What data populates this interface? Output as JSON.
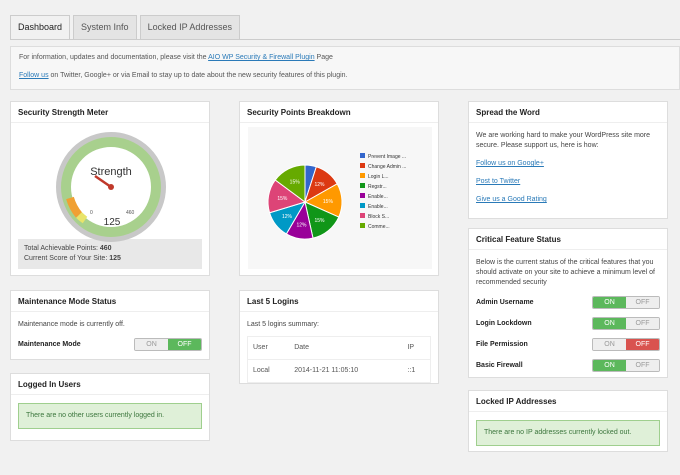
{
  "tabs": [
    "Dashboard",
    "System Info",
    "Locked IP Addresses"
  ],
  "notice": {
    "line1_prefix": "For information, updates and documentation, please visit the",
    "line1_link": "AIO WP Security & Firewall Plugin",
    "line1_suffix": "Page",
    "line2_link": "Follow us",
    "line2_text": "on Twitter, Google+ or via Email to stay up to date about the new security features of this plugin."
  },
  "meter": {
    "title": "Security Strength Meter",
    "gauge_label": "Strength",
    "score": "125",
    "min": "0",
    "max": "460",
    "value": 125,
    "total_label": "Total Achievable Points:",
    "total_value": "460",
    "current_label": "Current Score of Your Site:",
    "current_value": "125"
  },
  "breakdown": {
    "title": "Security Points Breakdown",
    "chart_data": {
      "type": "pie",
      "labels": [
        "Prevent Image...",
        "Change Admin ...",
        "Login L...",
        "Regstr...",
        "Enable...",
        "Enable...",
        "Block S...",
        "Comme..."
      ],
      "values": [
        5,
        12,
        15,
        15,
        12,
        12,
        15,
        15
      ],
      "slice_labels": [
        "",
        "12%",
        "15%",
        "15%",
        "12%",
        "12%",
        "15%",
        "15%"
      ],
      "colors": [
        "#3366cc",
        "#dc3912",
        "#ff9900",
        "#109618",
        "#990099",
        "#0099c6",
        "#dd4477",
        "#66aa00"
      ]
    },
    "legend_display": [
      "Prevent Image ...",
      "Change Admin ...",
      "Login L...",
      "Regstr...",
      "Enable...",
      "Enable...",
      "Block S...",
      "Comme..."
    ]
  },
  "spread": {
    "title": "Spread the Word",
    "text": "We are working hard to make your WordPress site more secure. Please support us, here is how:",
    "links": [
      "Follow us on Google+",
      "Post to Twitter",
      "Give us a Good Rating"
    ]
  },
  "maintenance": {
    "title": "Maintenance Mode Status",
    "text": "Maintenance mode is currently off.",
    "label": "Maintenance Mode",
    "on": "ON",
    "off": "OFF"
  },
  "logins": {
    "title": "Last 5 Logins",
    "summary": "Last 5 logins summary:",
    "headers": [
      "User",
      "Date",
      "IP"
    ],
    "rows": [
      [
        "Local",
        "2014-11-21 11:05:10",
        "::1"
      ]
    ]
  },
  "critical": {
    "title": "Critical Feature Status",
    "text": "Below is the current status of the critical features that you should activate on your site to achieve a minimum level of recommended security",
    "features": [
      {
        "label": "Admin Username",
        "state": "on"
      },
      {
        "label": "Login Lockdown",
        "state": "on"
      },
      {
        "label": "File Permission",
        "state": "off"
      },
      {
        "label": "Basic Firewall",
        "state": "on"
      }
    ],
    "on": "ON",
    "off": "OFF"
  },
  "logged": {
    "title": "Logged In Users",
    "message": "There are no other users currently logged in."
  },
  "locked": {
    "title": "Locked IP Addresses",
    "message": "There are no IP addresses currently locked out."
  }
}
